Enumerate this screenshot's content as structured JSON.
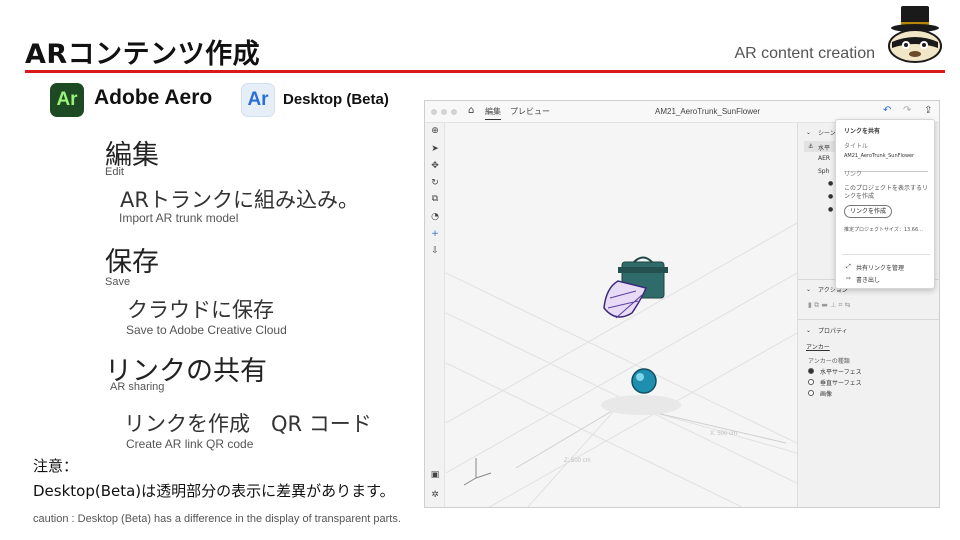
{
  "slide": {
    "title": "ARコンテンツ作成",
    "subtitle_en": "AR content creation",
    "products": [
      {
        "badge": "Ar",
        "name": "Adobe Aero"
      },
      {
        "badge": "Ar",
        "name": "Desktop (Beta)"
      }
    ],
    "sections": {
      "edit": {
        "jp": "編集",
        "en": "Edit"
      },
      "import": {
        "jp": "ARトランクに組み込み。",
        "en": "Import AR trunk model"
      },
      "save": {
        "jp": "保存",
        "en": "Save"
      },
      "cloud": {
        "jp": "クラウドに保存",
        "en": "Save to Adobe Creative Cloud"
      },
      "share": {
        "jp": "リンクの共有",
        "en": "AR sharing"
      },
      "qr": {
        "jp": "リンクを作成　QR コード",
        "en": "Create AR link QR code"
      }
    },
    "note_label": "注意：",
    "note_text": "Desktop(Beta)は透明部分の表示に差異があります。",
    "caution": "caution : Desktop (Beta) has a difference in the display of transparent parts."
  },
  "app": {
    "tabs": [
      "編集",
      "プレビュー"
    ],
    "filename": "AM21_AeroTrunk_SunFlower",
    "panel": {
      "scene_label": "シーン",
      "scene_rows": [
        "水平",
        "AER",
        "Sph"
      ],
      "actions_label": "アクション",
      "properties_label": "プロパティ",
      "anchor_label": "アンカー",
      "anchor_type_label": "アンカーの種類",
      "anchor_options": [
        {
          "label": "水平サーフェス",
          "selected": true
        },
        {
          "label": "垂直サーフェス",
          "selected": false
        },
        {
          "label": "画像",
          "selected": false
        }
      ]
    },
    "share_popover": {
      "heading": "リンクを共有",
      "title_label": "タイトル",
      "title_value": "AM21_AeroTrunk_SunFlower",
      "link_label": "リンク",
      "link_desc_1": "このプロジェクトを表示するリ",
      "link_desc_2": "ンクを作成",
      "create_button": "リンクを作成",
      "size_text": "推定プロジェクトサイズ：13.66...",
      "manage_link": "共有リンクを管理",
      "export_link": "書き出し"
    },
    "viewport_axes": {
      "x": "X: 500 cm",
      "z": "Z: 500 cm"
    }
  }
}
